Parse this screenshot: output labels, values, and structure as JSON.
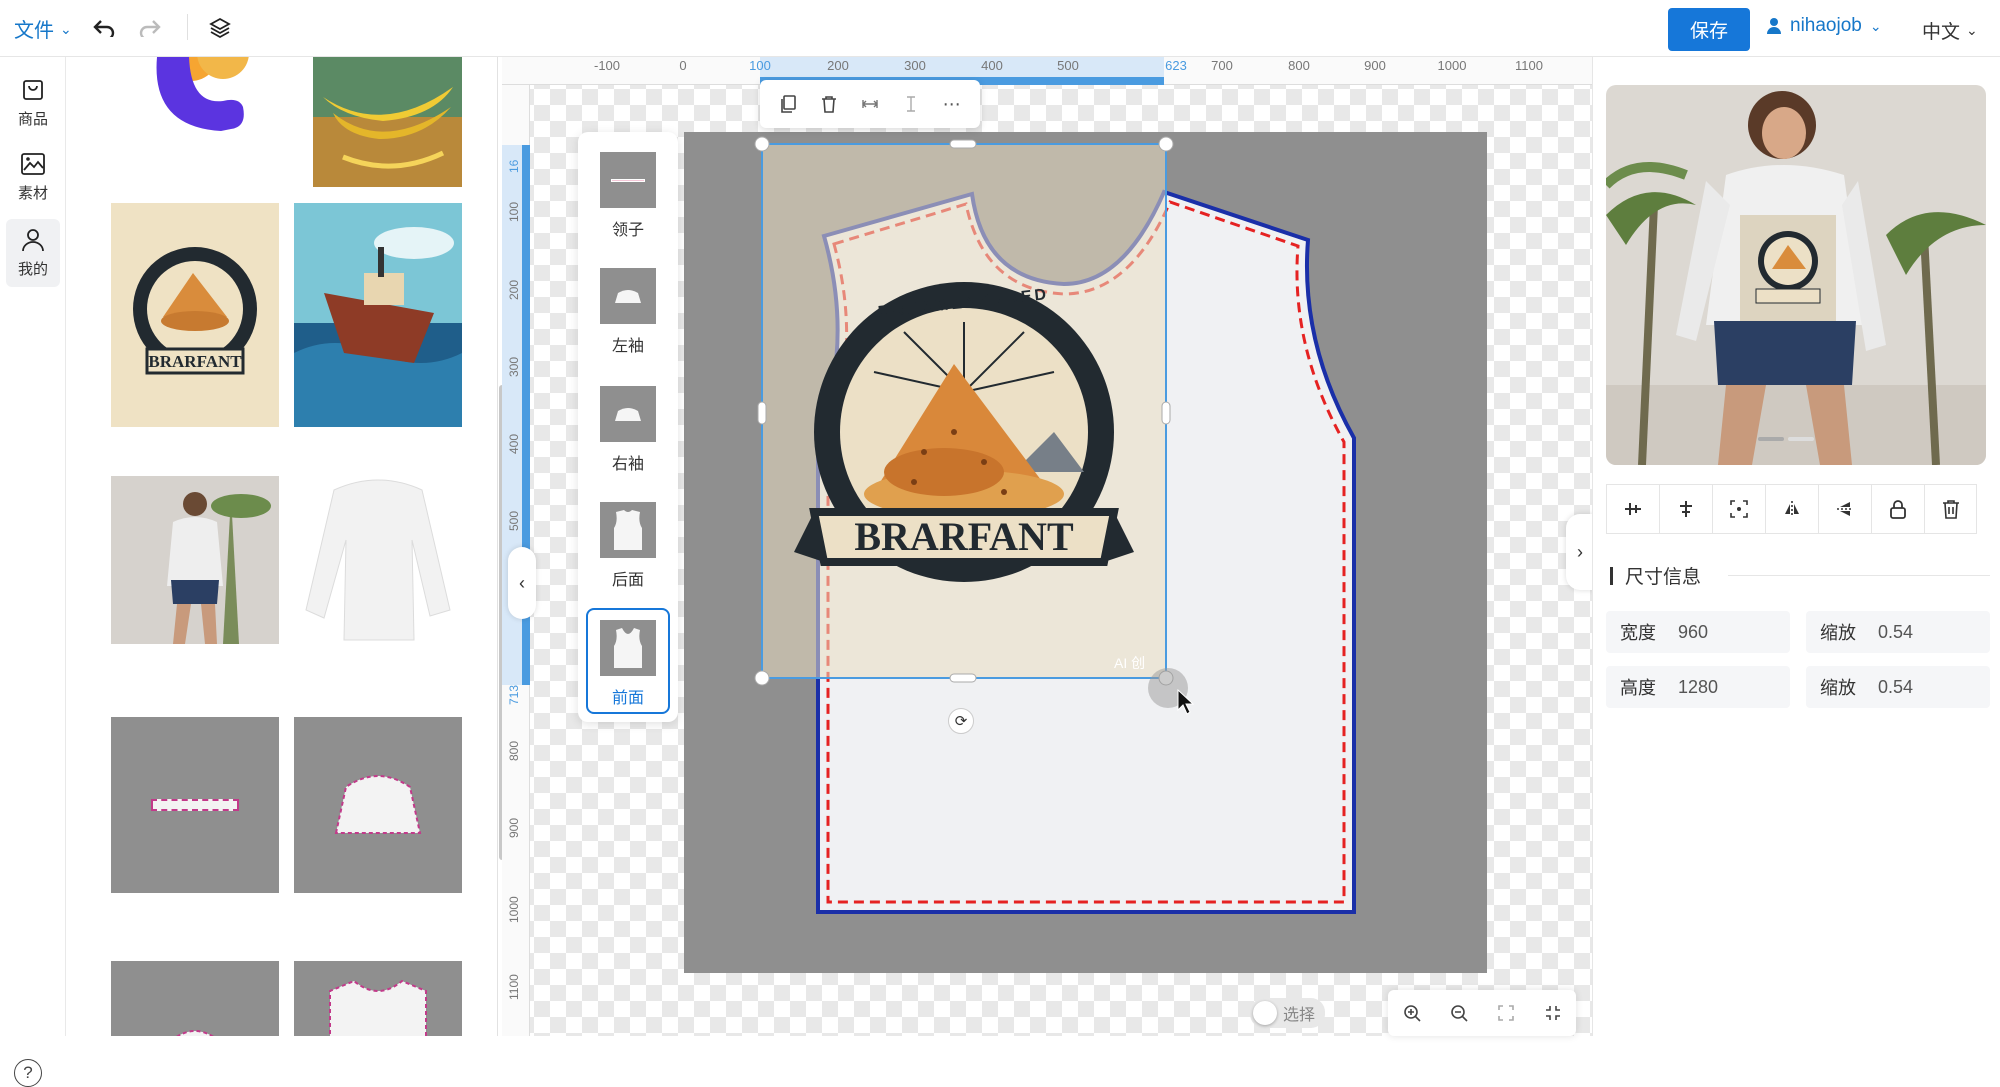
{
  "topbar": {
    "file_menu": "文件",
    "save_label": "保存",
    "user_name": "nihaojob",
    "language": "中文"
  },
  "rail": {
    "items": [
      {
        "label": "商品"
      },
      {
        "label": "素材"
      },
      {
        "label": "我的"
      }
    ],
    "help": "?"
  },
  "ruler": {
    "top_ticks": [
      "-100",
      "0",
      "100",
      "200",
      "300",
      "400",
      "500",
      "623",
      "700",
      "800",
      "900",
      "1000",
      "1100"
    ],
    "left_ticks": [
      "16",
      "100",
      "200",
      "300",
      "400",
      "500",
      "713",
      "800",
      "900",
      "1000",
      "1100"
    ]
  },
  "parts": [
    {
      "label": "领子"
    },
    {
      "label": "左袖"
    },
    {
      "label": "右袖"
    },
    {
      "label": "后面"
    },
    {
      "label": "前面"
    }
  ],
  "artwork": {
    "badge_arc_text": "BREAMENEERED",
    "banner_text": "BRARFANT",
    "watermark": "AI 创"
  },
  "canvas": {
    "select_toggle": "选择"
  },
  "size_info": {
    "title": "尺寸信息",
    "width_label": "宽度",
    "width_value": "960",
    "height_label": "高度",
    "height_value": "1280",
    "scale_label_1": "缩放",
    "scale_value_1": "0.54",
    "scale_label_2": "缩放",
    "scale_value_2": "0.54"
  },
  "colors": {
    "accent": "#1677d9",
    "selection": "#4a9be0",
    "pattern_outline": "#1a2fa8",
    "seam_line": "#e52222"
  }
}
